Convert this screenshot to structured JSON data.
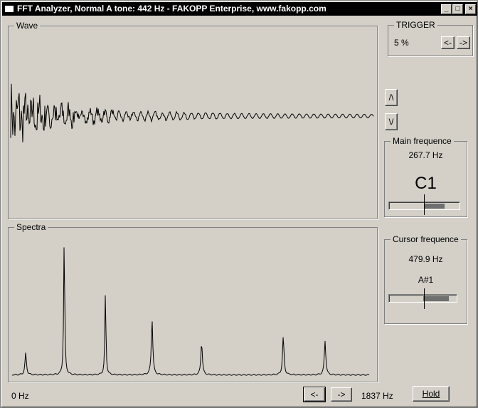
{
  "window": {
    "title": "FFT Analyzer, Normal A tone: 442 Hz - FAKOPP Enterprise, www.fakopp.com",
    "minimize_glyph": "_",
    "maximize_glyph": "□",
    "close_glyph": "×"
  },
  "wave": {
    "label": "Wave",
    "scale_up_label": "/\\",
    "scale_down_label": "\\/"
  },
  "trigger": {
    "label": "TRIGGER",
    "value": "5 %",
    "left_label": "<-",
    "right_label": "->"
  },
  "main_frequency": {
    "label": "Main frequence",
    "value": "267.7 Hz",
    "note": "C1",
    "meter_fraction": 0.3
  },
  "spectra": {
    "label": "Spectra",
    "min_label": "0 Hz",
    "max_label": "1837 Hz",
    "left_label": "<-",
    "right_label": "->",
    "peaks": [
      {
        "hz": 70,
        "level": 0.2
      },
      {
        "hz": 268,
        "level": 1.0
      },
      {
        "hz": 480,
        "level": 0.6
      },
      {
        "hz": 720,
        "level": 0.41
      },
      {
        "hz": 975,
        "level": 0.24
      },
      {
        "hz": 1395,
        "level": 0.28
      },
      {
        "hz": 1610,
        "level": 0.25
      }
    ]
  },
  "cursor_frequency": {
    "label": "Cursor frequence",
    "value": "479.9 Hz",
    "note": "A#1",
    "meter_fraction": 0.4
  },
  "hold": {
    "label": "Hold",
    "accesskey": "H"
  }
}
